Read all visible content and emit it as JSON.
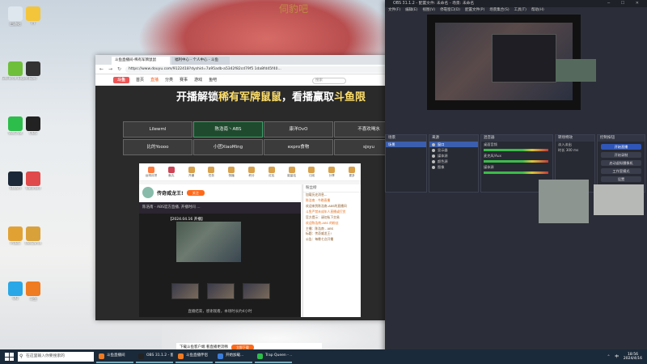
{
  "desktop": {
    "watermark": "伺豹吧",
    "icons": [
      {
        "label": "回收站",
        "color": "#dfe7ee"
      },
      {
        "label": "GeForce Experience",
        "color": "#6fbf3a"
      },
      {
        "label": "WeChat",
        "color": "#2dbd4b"
      },
      {
        "label": "Steam",
        "color": "#1b2838"
      },
      {
        "label": "PUBG",
        "color": "#e2a233"
      },
      {
        "label": "QQ",
        "color": "#2aa7e6"
      },
      {
        "label": "YY",
        "color": "#f3c53a"
      },
      {
        "label": "Epic",
        "color": "#333"
      },
      {
        "label": "OBS",
        "color": "#222"
      },
      {
        "label": "Valorant",
        "color": "#e04a4a"
      },
      {
        "label": "WeGame",
        "color": "#d9a13a"
      },
      {
        "label": "斗鱼",
        "color": "#ef7b22"
      }
    ]
  },
  "browser": {
    "tabs": [
      "斗鱼直播间-稀有军牌鼠鼠",
      "福利中心 - 个人中心 - 斗鱼"
    ],
    "url": "https://www.douyu.com/9122418?dyshid=7a95adb-a5342f82cd79f5 1da8fd45f40...",
    "logo": "斗鱼",
    "nav": [
      "首页",
      "直播",
      "分类",
      "赛事",
      "游戏",
      "鱼吧"
    ],
    "search_placeholder": "搜索",
    "banner": {
      "part1": "开播解锁",
      "part2": "稀有军牌鼠鼠",
      "part3": "，看播赢取",
      "part4": "斗鱼限"
    },
    "grid": [
      "Lilewml",
      "陈浩南丶ABS",
      "康洋OvO",
      "不喜欢喝水",
      "比的Yoooo",
      "小团XiaoMing",
      "expro食物",
      "sjsyu"
    ],
    "selected_cell": 1,
    "gifts": [
      {
        "label": "台湾月饼",
        "color": "#ff7a3b"
      },
      {
        "label": "鱼丸",
        "color": "#c45"
      },
      {
        "label": "开通",
        "color": "#d9a14a"
      },
      {
        "label": "任务",
        "color": "#d9a14a"
      },
      {
        "label": "快播",
        "color": "#d9a14a"
      },
      {
        "label": "积分",
        "color": "#d9a14a"
      },
      {
        "label": "红包",
        "color": "#d9a14a"
      },
      {
        "label": "能量站",
        "color": "#d9a14a"
      },
      {
        "label": "订阅",
        "color": "#d9a14a"
      },
      {
        "label": "分享",
        "color": "#d9a14a"
      },
      {
        "label": "更多",
        "color": "#d9a14a"
      }
    ],
    "anchor": {
      "name": "传奇威龙王!",
      "follow": "关注",
      "level": "主播"
    },
    "video": {
      "title": "陈浩南 - ABS官方直播, 开播时间 ...",
      "caption": "【2024.04.16 开播】",
      "footer": "直播结束，感谢观看，本场时长约4小时"
    },
    "chat": {
      "header": "粉丝榜",
      "messages": [
        "加载历史消息...",
        "陈浩南 · 今晚直播",
        "欢迎来到陈浩南-ABS的直播间",
        "斗鱼严禁未成年人直播或打赏",
        "官方提示：请勿私下交易",
        "欢迎陈浩南-ABS 的粉丝",
        "主播：陈浩南 - ABS",
        "标题：传奇威龙王!",
        "公告：每晚七点开播"
      ]
    },
    "download_bar": {
      "text": "下载斗鱼客户端 看直播更流畅",
      "button": "立即下载"
    }
  },
  "obs": {
    "title": "OBS 31.1.2 - 配置文件: 未命名 - 场景: 未命名",
    "menu": [
      "文件(F)",
      "编辑(E)",
      "视图(V)",
      "停靠窗口(D)",
      "配置文件(P)",
      "场景集合(S)",
      "工具(T)",
      "帮助(H)"
    ],
    "docks": {
      "scenes": {
        "title": "场景",
        "items": [
          "场景"
        ]
      },
      "sources": {
        "title": "来源",
        "items": [
          "窗口",
          "显示器",
          "媒体源",
          "颜色源",
          "图像"
        ]
      },
      "mixer": {
        "title": "混音器",
        "items": [
          "桌面音频",
          "麦克风/Aux",
          "媒体源"
        ]
      },
      "transitions": {
        "title": "转场特效",
        "items": [
          "淡入淡出",
          "时长 300 ms"
        ]
      },
      "controls": {
        "title": "控制按钮",
        "buttons": [
          "开始直播",
          "开始录制",
          "启动虚拟摄像机",
          "工作室模式",
          "设置",
          "退出"
        ]
      }
    },
    "status": "CPU: 2.1%  60.00 / 60.00 FPS"
  },
  "taskbar": {
    "search": "在这里输入你要搜索的",
    "apps": [
      {
        "label": "斗鱼直播间",
        "color": "#ef7b22"
      },
      {
        "label": "OBS 31.1.2 - 配置",
        "color": "#222"
      },
      {
        "label": "斗鱼直播伴侣",
        "color": "#ef7b22"
      },
      {
        "label": "开始加载...",
        "color": "#3b7dd8"
      },
      {
        "label": "Trap Queen - ...",
        "color": "#2dbd4b"
      }
    ],
    "time": "18:56",
    "date": "2024/4/16",
    "lang": "中"
  }
}
